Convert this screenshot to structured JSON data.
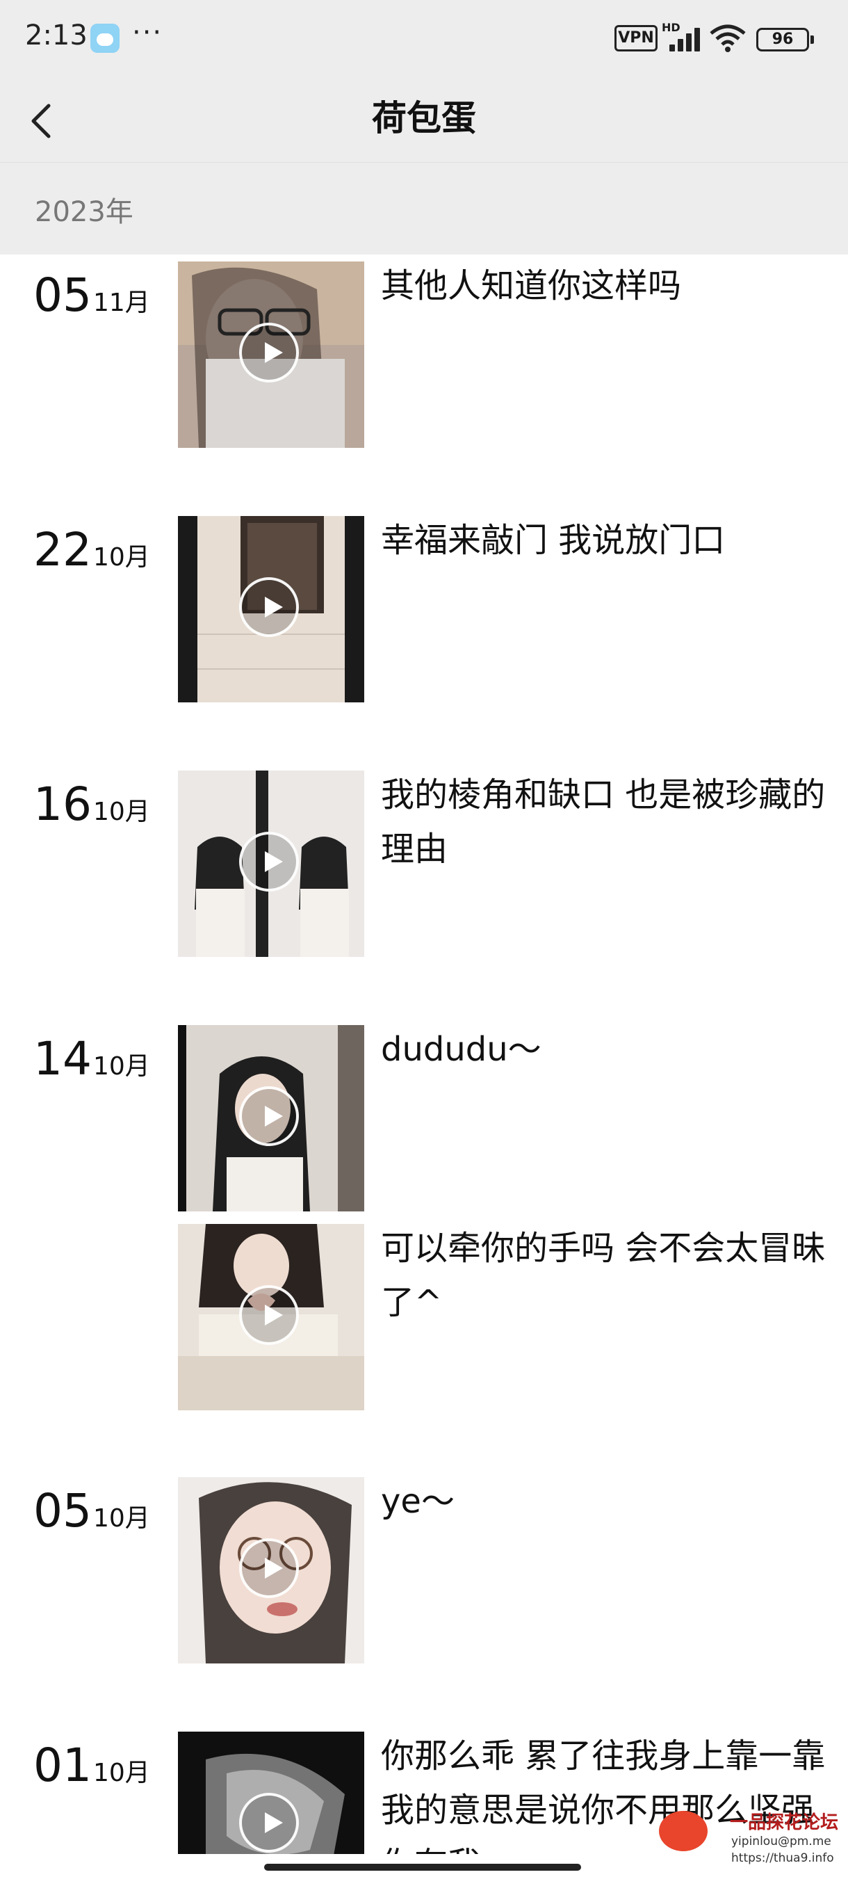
{
  "status_bar": {
    "time": "2:13",
    "more": "···",
    "vpn": "VPN",
    "hd": "HD",
    "battery": "96"
  },
  "header": {
    "title": "荷包蛋"
  },
  "year": "2023年",
  "posts": [
    {
      "day": "05",
      "month": "11月",
      "caption": "其他人知道你这样吗",
      "thumb": "photo-1"
    },
    {
      "day": "22",
      "month": "10月",
      "caption": "幸福来敲门 我说放门口",
      "thumb": "photo-2"
    },
    {
      "day": "16",
      "month": "10月",
      "caption": "我的棱角和缺口 也是被珍藏的理由",
      "thumb": "photo-3"
    },
    {
      "day": "14",
      "month": "10月",
      "caption": "dududu～",
      "thumb": "photo-4"
    },
    {
      "day": "",
      "month": "",
      "caption": "可以牵你的手吗 会不会太冒昧了^",
      "thumb": "photo-5"
    },
    {
      "day": "05",
      "month": "10月",
      "caption": "ye～",
      "thumb": "photo-6"
    },
    {
      "day": "01",
      "month": "10月",
      "caption": "你那么乖 累了往我身上靠一靠 我的意思是说你不用那么坚强 你有我",
      "thumb": "photo-7"
    }
  ],
  "watermark": {
    "title": "一品探花论坛",
    "email": "yipinlou@pm.me",
    "url": "https://thua9.info"
  },
  "colors": {
    "header_bg": "#ededed",
    "text": "#111111",
    "year_text": "#777777"
  }
}
